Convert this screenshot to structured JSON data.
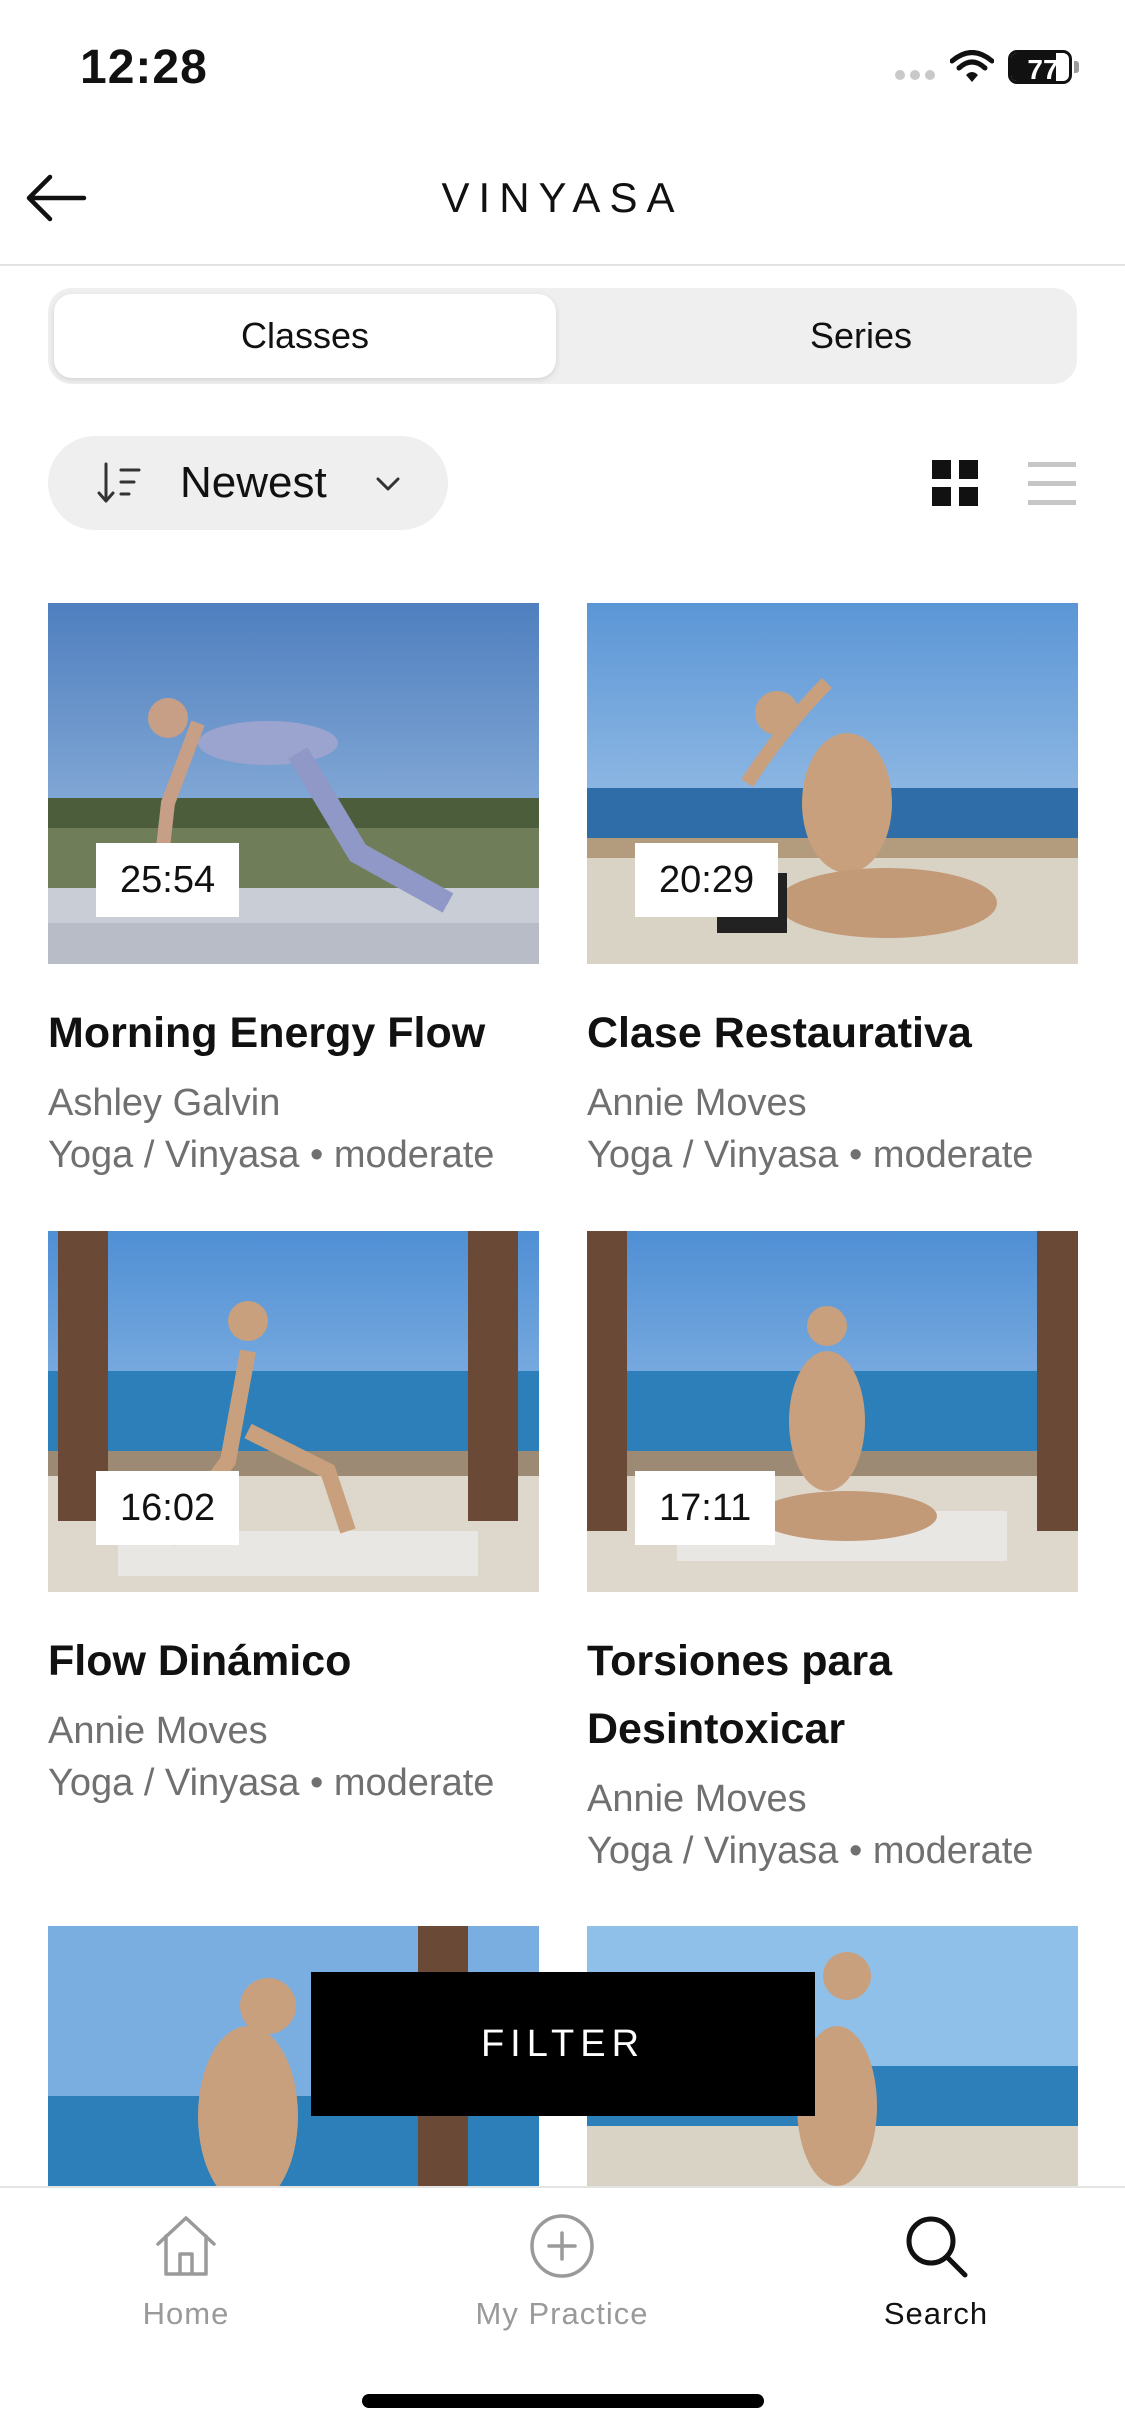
{
  "status_bar": {
    "time": "12:28",
    "battery": "77",
    "battery_level": 0.77
  },
  "header": {
    "title": "VINYASA"
  },
  "segments": [
    {
      "label": "Classes",
      "active": true
    },
    {
      "label": "Series",
      "active": false
    }
  ],
  "sort": {
    "label": "Newest"
  },
  "view_modes": {
    "grid": "grid-icon",
    "list": "list-icon",
    "selected": "grid"
  },
  "classes": [
    {
      "duration": "25:54",
      "title": "Morning Energy Flow",
      "instructor": "Ashley Galvin",
      "meta": "Yoga / Vinyasa • moderate"
    },
    {
      "duration": "20:29",
      "title": "Clase Restaurativa",
      "instructor": "Annie Moves",
      "meta": "Yoga / Vinyasa • moderate"
    },
    {
      "duration": "16:02",
      "title": "Flow Dinámico",
      "instructor": "Annie Moves",
      "meta": "Yoga / Vinyasa • moderate"
    },
    {
      "duration": "17:11",
      "title": "Torsiones para Desintoxicar",
      "instructor": "Annie Moves",
      "meta": "Yoga / Vinyasa • moderate"
    }
  ],
  "filter": {
    "label": "FILTER"
  },
  "tabs": [
    {
      "label": "Home",
      "icon": "home-icon",
      "active": false
    },
    {
      "label": "My Practice",
      "icon": "plus-circle-icon",
      "active": false
    },
    {
      "label": "Search",
      "icon": "search-icon",
      "active": true
    }
  ],
  "colors": {
    "accent": "#000000",
    "segment_bg": "#efefef",
    "muted_text": "#707070",
    "inactive_tab": "#9a9a9a"
  }
}
